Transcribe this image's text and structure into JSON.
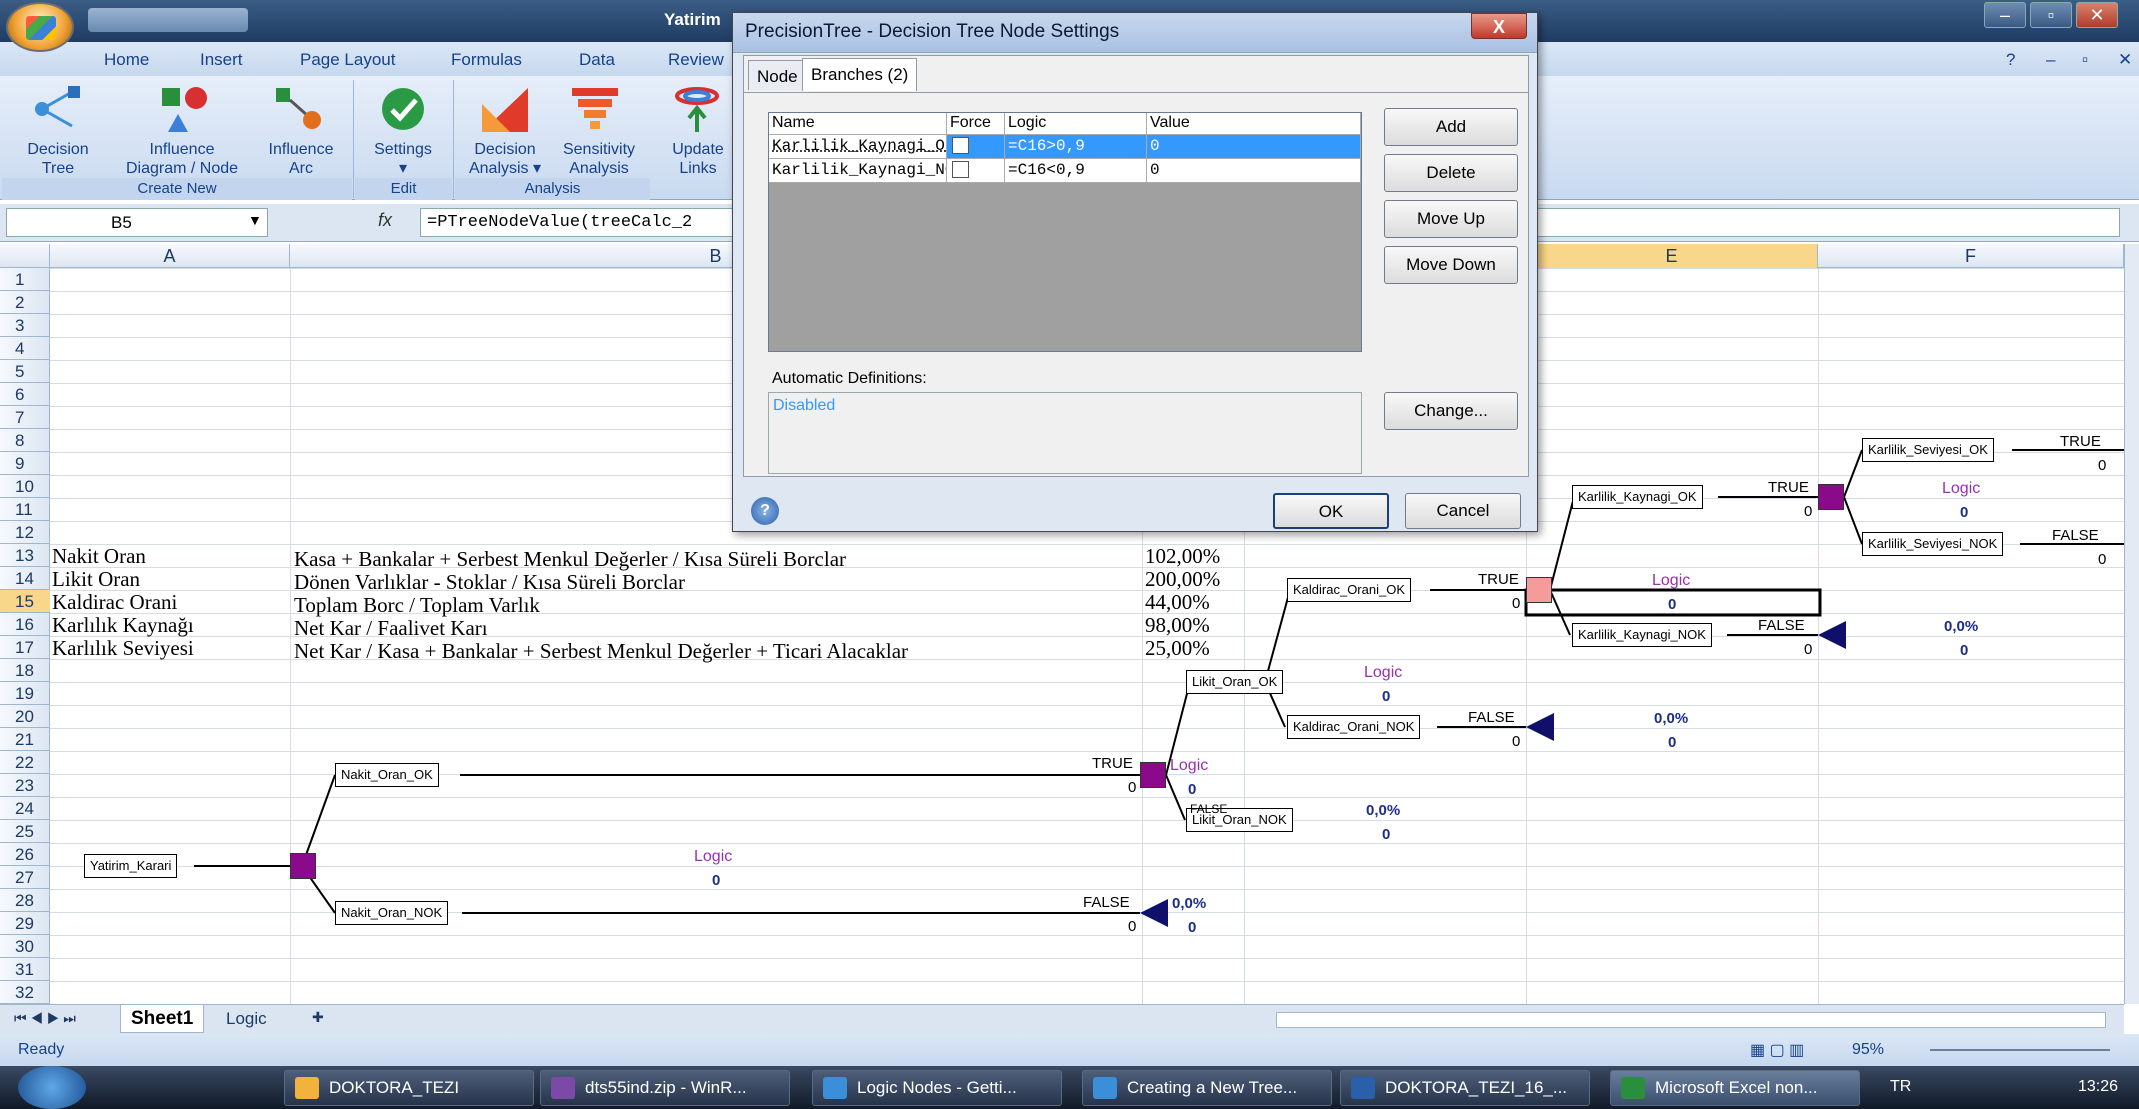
{
  "window": {
    "title": "Yatirim"
  },
  "ribbon": {
    "tabs": [
      "Home",
      "Insert",
      "Page Layout",
      "Formulas",
      "Data",
      "Review"
    ],
    "buttons": [
      {
        "l1": "Decision",
        "l2": "Tree"
      },
      {
        "l1": "Influence",
        "l2": "Diagram / Node"
      },
      {
        "l1": "Influence",
        "l2": "Arc"
      },
      {
        "l1": "Settings",
        "l2": "▾"
      },
      {
        "l1": "Decision",
        "l2": "Analysis ▾"
      },
      {
        "l1": "Sensitivity",
        "l2": "Analysis"
      },
      {
        "l1": "Update",
        "l2": "Links"
      }
    ],
    "groups": [
      "Create New",
      "Edit",
      "Analysis"
    ]
  },
  "formula_bar": {
    "name_box": "B5",
    "fx": "fx",
    "formula": "=PTreeNodeValue(treeCalc_2"
  },
  "columns": [
    "A",
    "B",
    "E",
    "F"
  ],
  "rows": [
    "1",
    "2",
    "3",
    "4",
    "5",
    "6",
    "7",
    "8",
    "9",
    "10",
    "11",
    "12",
    "13",
    "14",
    "15",
    "16",
    "17",
    "18",
    "19",
    "20",
    "21",
    "22",
    "23",
    "24",
    "25",
    "26",
    "27",
    "28",
    "29",
    "30",
    "31",
    "32"
  ],
  "sheet": {
    "a": [
      "Nakit  Oran",
      "Likit  Oran",
      "Kaldirac  Orani",
      "Karlılık  Kaynağı",
      "Karlılık  Seviyesi"
    ],
    "b": [
      "Kasa + Bankalar + Serbest Menkul Değerler / Kısa Süreli Borclar",
      "Dönen Varlıklar - Stoklar / Kısa Süreli Borclar",
      "Toplam Borc / Toplam Varlık",
      "Net Kar / Faalivet Karı",
      "Net Kar / Kasa + Bankalar + Serbest Menkul Değerler + Ticari Alacaklar"
    ],
    "c": [
      "102,00%",
      "200,00%",
      "44,00%",
      "98,00%",
      "25,00%"
    ]
  },
  "tree": {
    "nodes": [
      "Yatirim_Karari",
      "Nakit_Oran_OK",
      "Nakit_Oran_NOK",
      "Likit_Oran_OK",
      "Likit_Oran_NOK",
      "Kaldirac_Orani_OK",
      "Kaldirac_Orani_NOK",
      "Karlilik_Kaynagi_OK",
      "Karlilik_Kaynagi_NOK",
      "Karlilik_Seviyesi_OK",
      "Karlilik_Seviyesi_NOK"
    ],
    "true": "TRUE",
    "false": "FALSE",
    "logic": "Logic",
    "zero": "0",
    "pct": "0,0%",
    "partial": "FALSE"
  },
  "dialog": {
    "title": "PrecisionTree - Decision Tree Node Settings",
    "close": "X",
    "tabs": [
      "Node",
      "Branches (2)"
    ],
    "headers": [
      "Name",
      "Force",
      "Logic",
      "Value"
    ],
    "rows": [
      {
        "name": "Karlilik_Kaynagi_OK",
        "logic": "=C16>0,9",
        "value": "0"
      },
      {
        "name": "Karlilik_Kaynagi_NOK",
        "logic": "=C16<0,9",
        "value": "0"
      }
    ],
    "buttons": [
      "Add",
      "Delete",
      "Move Up",
      "Move Down"
    ],
    "auto_label": "Automatic Definitions:",
    "auto_value": "Disabled",
    "change": "Change...",
    "ok": "OK",
    "cancel": "Cancel",
    "help": "?"
  },
  "sheettabs": [
    "Sheet1",
    "Logic"
  ],
  "status": {
    "ready": "Ready",
    "zoom": "95%"
  },
  "taskbar": {
    "items": [
      "DOKTORA_TEZI",
      "dts55ind.zip - WinR...",
      "Logic Nodes - Getti...",
      "Creating a New Tree...",
      "DOKTORA_TEZI_16_...",
      "Microsoft Excel non..."
    ],
    "lang": "TR",
    "time": "13:26"
  }
}
